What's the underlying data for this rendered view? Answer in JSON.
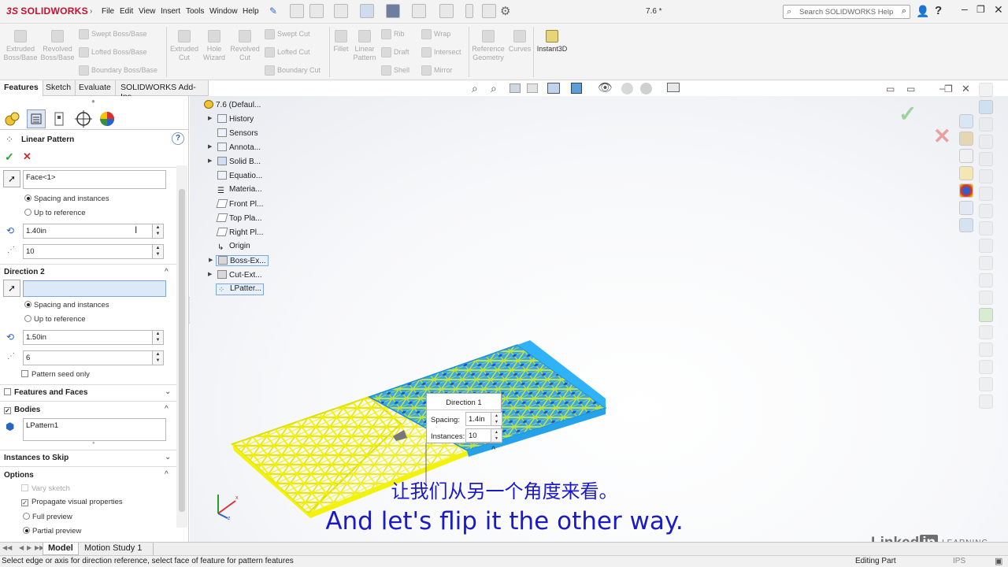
{
  "app": {
    "brand": "SOLIDWORKS",
    "doc_title": "7.6 *",
    "search_placeholder": "Search SOLIDWORKS Help"
  },
  "menu": [
    "File",
    "Edit",
    "View",
    "Insert",
    "Tools",
    "Window",
    "Help"
  ],
  "ribbon": {
    "extruded_boss": "Extruded Boss/Base",
    "revolved_boss": "Revolved Boss/Base",
    "swept_boss": "Swept Boss/Base",
    "lofted_boss": "Lofted Boss/Base",
    "boundary_boss": "Boundary Boss/Base",
    "extruded_cut": "Extruded Cut",
    "hole_wizard": "Hole Wizard",
    "revolved_cut": "Revolved Cut",
    "swept_cut": "Swept Cut",
    "lofted_cut": "Lofted Cut",
    "boundary_cut": "Boundary Cut",
    "fillet": "Fillet",
    "linear_pattern": "Linear Pattern",
    "rib": "Rib",
    "draft": "Draft",
    "shell": "Shell",
    "wrap": "Wrap",
    "intersect": "Intersect",
    "mirror": "Mirror",
    "reference_geometry": "Reference Geometry",
    "curves": "Curves",
    "instant3d": "Instant3D"
  },
  "tabs": [
    "Features",
    "Sketch",
    "Evaluate",
    "SOLIDWORKS Add-Ins"
  ],
  "property_manager": {
    "title": "Linear Pattern",
    "dir1": {
      "reference": "Face<1>",
      "opt_spacing": "Spacing and instances",
      "opt_reference": "Up to reference",
      "spacing": "1.40in",
      "instances": "10"
    },
    "dir2": {
      "header": "Direction 2",
      "reference": "",
      "opt_spacing": "Spacing and instances",
      "opt_reference": "Up to reference",
      "spacing": "1.50in",
      "instances": "6",
      "seed_only": "Pattern seed only"
    },
    "features_and_faces": "Features and Faces",
    "bodies": {
      "header": "Bodies",
      "item": "LPattern1"
    },
    "instances_to_skip": "Instances to Skip",
    "options": {
      "header": "Options",
      "vary_sketch": "Vary sketch",
      "propagate": "Propagate visual properties",
      "full_preview": "Full preview",
      "partial_preview": "Partial preview"
    }
  },
  "tree": {
    "root": "7.6  (Defaul...",
    "items": [
      "History",
      "Sensors",
      "Annota...",
      "Solid B...",
      "Equatio...",
      "Materia...",
      "Front Pl...",
      "Top Pla...",
      "Right Pl...",
      "Origin",
      "Boss-Ex...",
      "Cut-Ext...",
      "LPatter..."
    ]
  },
  "callout": {
    "title": "Direction 1",
    "spacing_label": "Spacing:",
    "spacing": "1.4in",
    "instances_label": "Instances:",
    "instances": "10"
  },
  "subtitles": {
    "zh": "让我们从另一个角度来看。",
    "en": "And let's flip it the other way."
  },
  "bottom_tabs": [
    "Model",
    "Motion Study 1"
  ],
  "status": {
    "message": "Select edge or axis for direction reference, select face of feature for pattern features",
    "mode": "Editing Part",
    "units": "IPS"
  },
  "watermark": {
    "linked": "Linked",
    "in": "in",
    "learning": "LEARNING"
  },
  "colors": {
    "pattern_yellow": "#f2f20a",
    "body_blue": "#39b3f5",
    "subtitle": "#1a1ac8",
    "accept_green": "#2aa52a",
    "cancel_red": "#d42a2a"
  }
}
